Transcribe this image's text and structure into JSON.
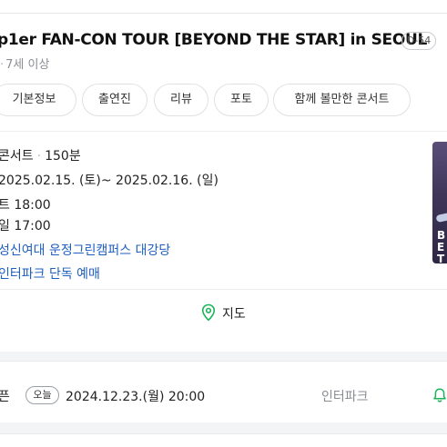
{
  "header": {
    "title": "p1er FAN-CON TOUR [BEYOND THE STAR] in SEOUL",
    "dday": "D-54",
    "age_rating": "7세 이상"
  },
  "tabs": [
    {
      "label": "기본정보"
    },
    {
      "label": "출연진"
    },
    {
      "label": "리뷰"
    },
    {
      "label": "포토"
    },
    {
      "label": "함께 볼만한 콘서트"
    }
  ],
  "info": {
    "genre": "콘서트",
    "runtime": "150분",
    "period": "2025.02.15. (토)~ 2025.02.16. (일)",
    "time1": "트 18:00",
    "time2": "일 17:00",
    "venue": "성신여대 운정그린캠퍼스 대강당",
    "ticketing": "인터파크 단독 예매"
  },
  "poster": {
    "text": "BE THE"
  },
  "map": {
    "label": "지도",
    "icon": "map-pin-icon",
    "accent": "#19b35a"
  },
  "ticket": {
    "label": "픈",
    "today_badge": "오늘",
    "open_datetime": "2024.12.23.(월) 20:00",
    "vendor": "인터파크",
    "bell_icon": "bell-icon",
    "bell_color": "#19b35a"
  },
  "colors": {
    "link": "#1f5fbf",
    "muted": "#8a8d93",
    "background": "#f3f4f6"
  }
}
